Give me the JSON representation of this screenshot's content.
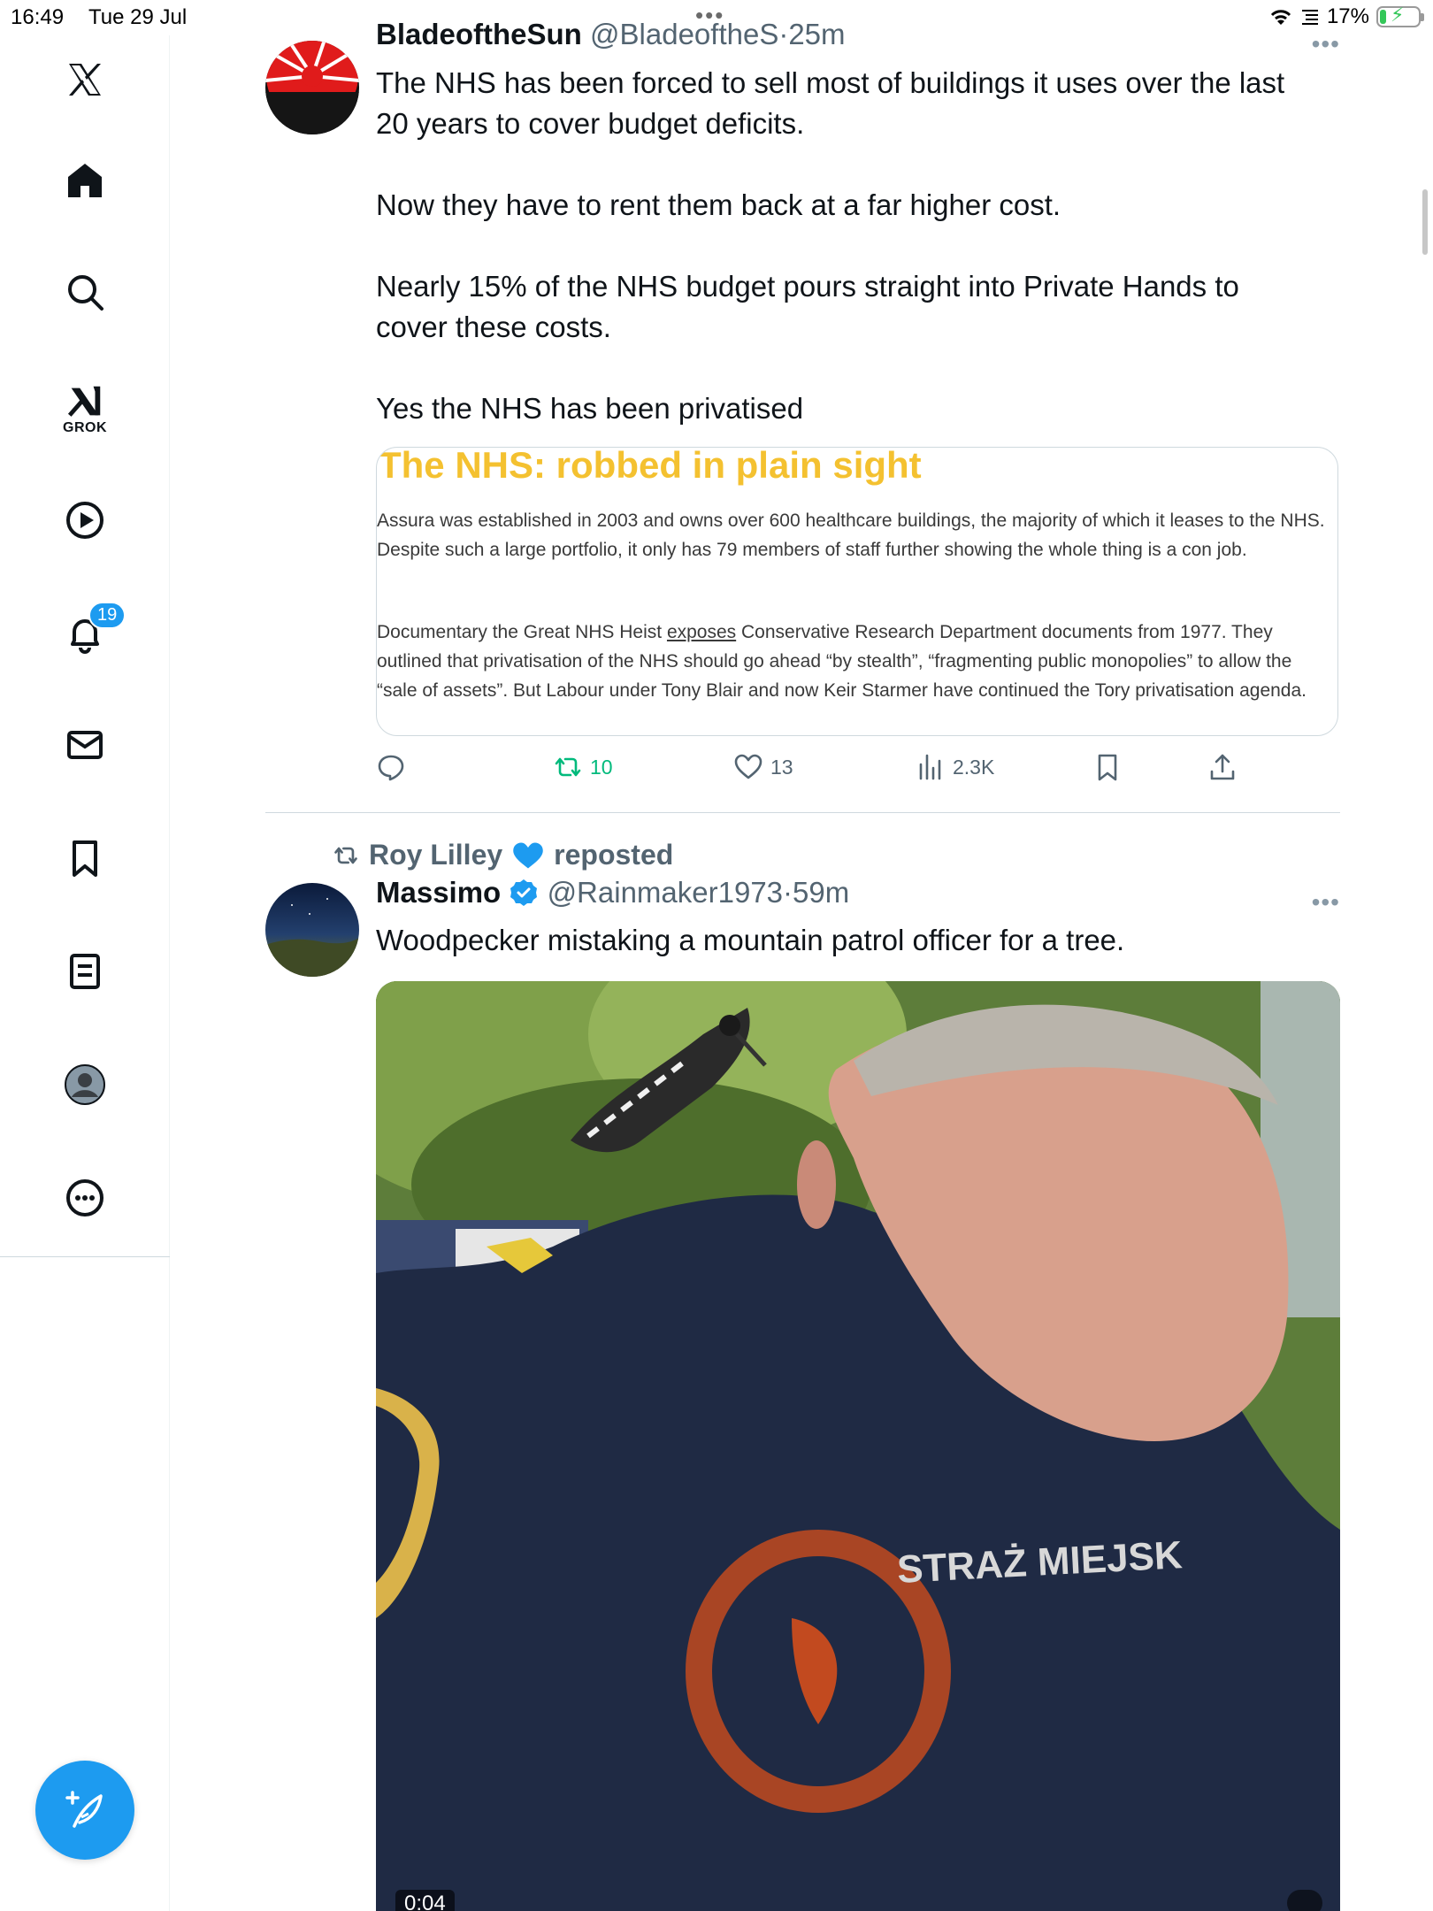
{
  "status_bar": {
    "time": "16:49",
    "date": "Tue 29 Jul",
    "battery_percent": "17%",
    "battery_level": 0.17
  },
  "sidebar": {
    "items": [
      {
        "name": "x-logo-icon"
      },
      {
        "name": "home-icon"
      },
      {
        "name": "search-icon"
      },
      {
        "name": "grok-icon",
        "label": "GROK"
      },
      {
        "name": "video-icon"
      },
      {
        "name": "notifications-icon",
        "badge": "19"
      },
      {
        "name": "messages-icon"
      },
      {
        "name": "bookmarks-icon"
      },
      {
        "name": "lists-icon"
      },
      {
        "name": "profile-icon"
      },
      {
        "name": "more-icon"
      }
    ]
  },
  "tweets": [
    {
      "display_name": "BladeoftheSun",
      "handle": "@BladeoftheS",
      "time": "·25m",
      "paragraphs": [
        "The NHS has been forced to sell most of buildings it uses over the last 20 years to cover budget deficits.",
        "Now they have to rent them back at a far higher cost.",
        "Nearly 15% of the NHS budget pours straight into Private Hands to cover these costs.",
        "Yes the NHS has been privatised"
      ],
      "card": {
        "title": "The NHS: robbed in plain sight",
        "para1": "Assura was established in 2003 and owns over 600 healthcare buildings, the majority of which it leases to the NHS. Despite such a large portfolio, it only has 79 members of staff further showing the whole thing is a con job.",
        "para2_before": "Documentary the Great NHS Heist ",
        "para2_link": "exposes",
        "para2_after": " Conservative Research Department documents from 1977. They outlined that privatisation of the NHS should go ahead “by stealth”, “fragmenting public monopolies” to allow the “sale of assets”. But Labour under Tony Blair and now Keir Starmer have continued the Tory privatisation agenda."
      },
      "actions": {
        "retweets": "10",
        "likes": "13",
        "views": "2.3K"
      }
    },
    {
      "reposted_by": "Roy Lilley",
      "reposted_label": "reposted",
      "display_name": "Massimo",
      "handle": "@Rainmaker1973",
      "time": "·59m",
      "text": "Woodpecker mistaking a mountain patrol officer for a tree.",
      "video_timer": "0:04"
    }
  ],
  "colors": {
    "accent": "#1d9bf0",
    "retweet_green": "#00ba7c",
    "card_title_yellow": "#f4c130",
    "secondary_text": "#536471"
  }
}
